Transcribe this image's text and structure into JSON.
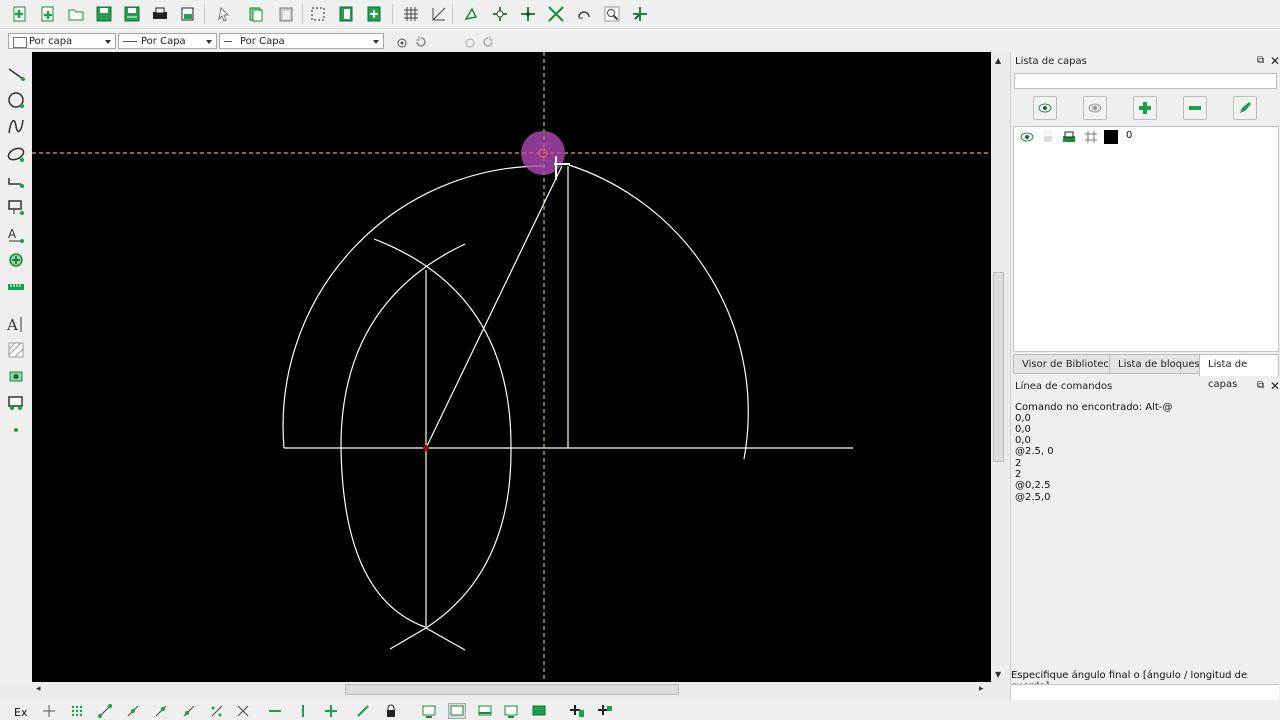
{
  "attributes": {
    "color_combo": "Por capa",
    "width_combo": "Por Capa",
    "linetype_combo": "Por Capa"
  },
  "layer_panel": {
    "title": "Lista de capas",
    "search_placeholder": "",
    "layers": [
      {
        "name": "0",
        "color": "#000000",
        "visible": true,
        "locked": false,
        "printable": true
      }
    ]
  },
  "tabs": [
    "Visor de Biblioteca",
    "Lista de bloques",
    "Lista de capas"
  ],
  "active_tab": "Lista de capas",
  "command_panel": {
    "title": "Línea de comandos",
    "history": [
      "Comando no encontrado: Alt-@",
      "0,0",
      "0,0",
      "0,0",
      "@2.5, 0",
      "2",
      "2",
      "@0,2.5",
      "@2.5,0"
    ],
    "prompt": "Especifique ángulo final o [ángulo / longitud de cuerda]"
  },
  "status_bar": {
    "snap_label": "Ex"
  },
  "colors": {
    "canvas_bg": "#000000",
    "entity": "#ffffff",
    "icon_accent": "#1aa04a",
    "cursor_highlight": "#b04ab4",
    "crosshair": "#ffd9a8"
  }
}
